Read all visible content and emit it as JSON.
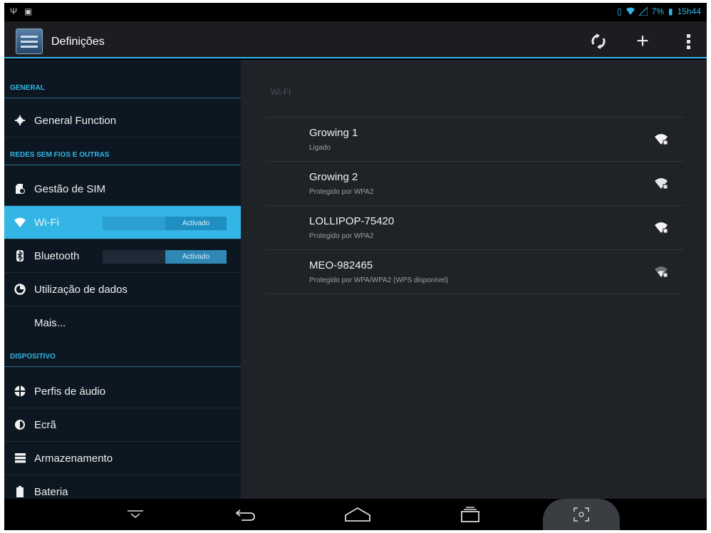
{
  "status_bar": {
    "left_icons": [
      "usb-icon",
      "image-icon"
    ],
    "battery_text": "7%",
    "time": "15h44",
    "right_icons": [
      "sim-icon",
      "wifi-signal-icon",
      "cell-signal-icon",
      "battery-icon"
    ]
  },
  "action_bar": {
    "title": "Definições",
    "icons": [
      "settings-app-icon",
      "sync-icon",
      "add-icon",
      "overflow-menu-icon"
    ],
    "add_glyph": "+",
    "accent": "#33b5e5"
  },
  "sidebar": {
    "sections": [
      {
        "header": "GENERAL",
        "items": [
          {
            "label": "General Function",
            "icon": "gear-icon"
          }
        ]
      },
      {
        "header": "REDES SEM FIOS E OUTRAS",
        "items": [
          {
            "label": "Gestão de SIM",
            "icon": "sim-card-icon"
          },
          {
            "label": "Wi-Fi",
            "icon": "wifi-icon",
            "toggle": "Activado",
            "selected": true
          },
          {
            "label": "Bluetooth",
            "icon": "bluetooth-icon",
            "toggle": "Activado"
          },
          {
            "label": "Utilização de dados",
            "icon": "data-usage-icon"
          },
          {
            "label": "Mais...",
            "icon": ""
          }
        ]
      },
      {
        "header": "DISPOSITIVO",
        "items": [
          {
            "label": "Perfis de áudio",
            "icon": "audio-profile-icon"
          },
          {
            "label": "Ecrã",
            "icon": "display-icon"
          },
          {
            "label": "Armazenamento",
            "icon": "storage-icon"
          },
          {
            "label": "Bateria",
            "icon": "battery-icon"
          }
        ]
      }
    ]
  },
  "wifi": {
    "heading": "Wi-Fi",
    "networks": [
      {
        "ssid": "Growing 1",
        "status": "Ligado",
        "icon": "wifi-secured-icon"
      },
      {
        "ssid": "Growing 2",
        "status": "Protegido por WPA2",
        "icon": "wifi-secured-icon"
      },
      {
        "ssid": "LOLLIPOP-75420",
        "status": "Protegido por WPA2",
        "icon": "wifi-secured-icon"
      },
      {
        "ssid": "MEO-982465",
        "status": "Protegido por WPA/WPA2 (WPS disponível)",
        "icon": "wifi-secured-weak-icon"
      }
    ]
  },
  "nav_bar": {
    "icons": [
      "hide-keyboard-icon",
      "back-icon",
      "home-icon",
      "recent-apps-icon",
      "screenshot-icon"
    ]
  }
}
